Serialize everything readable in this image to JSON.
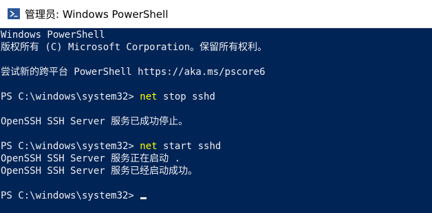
{
  "window": {
    "title": "管理员: Windows PowerShell",
    "icon": "powershell-icon"
  },
  "console": {
    "colors": {
      "background": "#012456",
      "text": "#eeedf0",
      "command": "#ffff00"
    },
    "banner1": "Windows PowerShell",
    "banner2": "版权所有 (C) Microsoft Corporation。保留所有权利。",
    "banner3": "尝试新的跨平台 PowerShell https://aka.ms/pscore6",
    "prompt": "PS C:\\windows\\system32> ",
    "cmd1": {
      "name": "net",
      "args": " stop sshd"
    },
    "out1": "OpenSSH SSH Server 服务已成功停止。",
    "cmd2": {
      "name": "net",
      "args": " start sshd"
    },
    "out2a": "OpenSSH SSH Server 服务正在启动 .",
    "out2b": "OpenSSH SSH Server 服务已经启动成功。"
  }
}
